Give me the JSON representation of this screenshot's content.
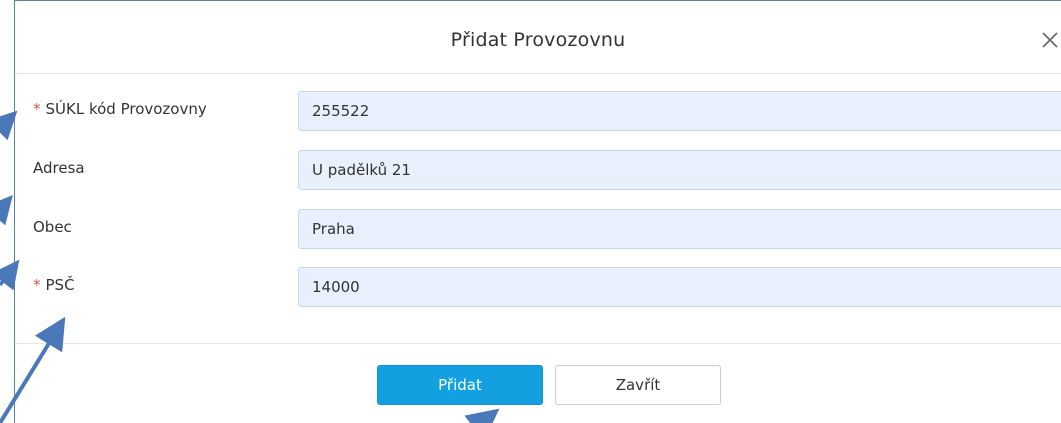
{
  "dialog": {
    "title": "Přidat Provozovnu",
    "close_icon": "close-icon"
  },
  "form": {
    "fields": [
      {
        "label": "SÚKL kód Provozovny",
        "required": true,
        "value": "255522"
      },
      {
        "label": "Adresa",
        "required": false,
        "value": "U padělků 21"
      },
      {
        "label": "Obec",
        "required": false,
        "value": "Praha"
      },
      {
        "label": "PSČ",
        "required": true,
        "value": "14000"
      }
    ],
    "required_marker": "*"
  },
  "footer": {
    "submit_label": "Přidat",
    "close_label": "Zavřít"
  },
  "colors": {
    "primary": "#13a0e0",
    "required": "#d9534f",
    "input_bg": "#e8f0fe",
    "annotation_arrow": "#4a78b8"
  }
}
